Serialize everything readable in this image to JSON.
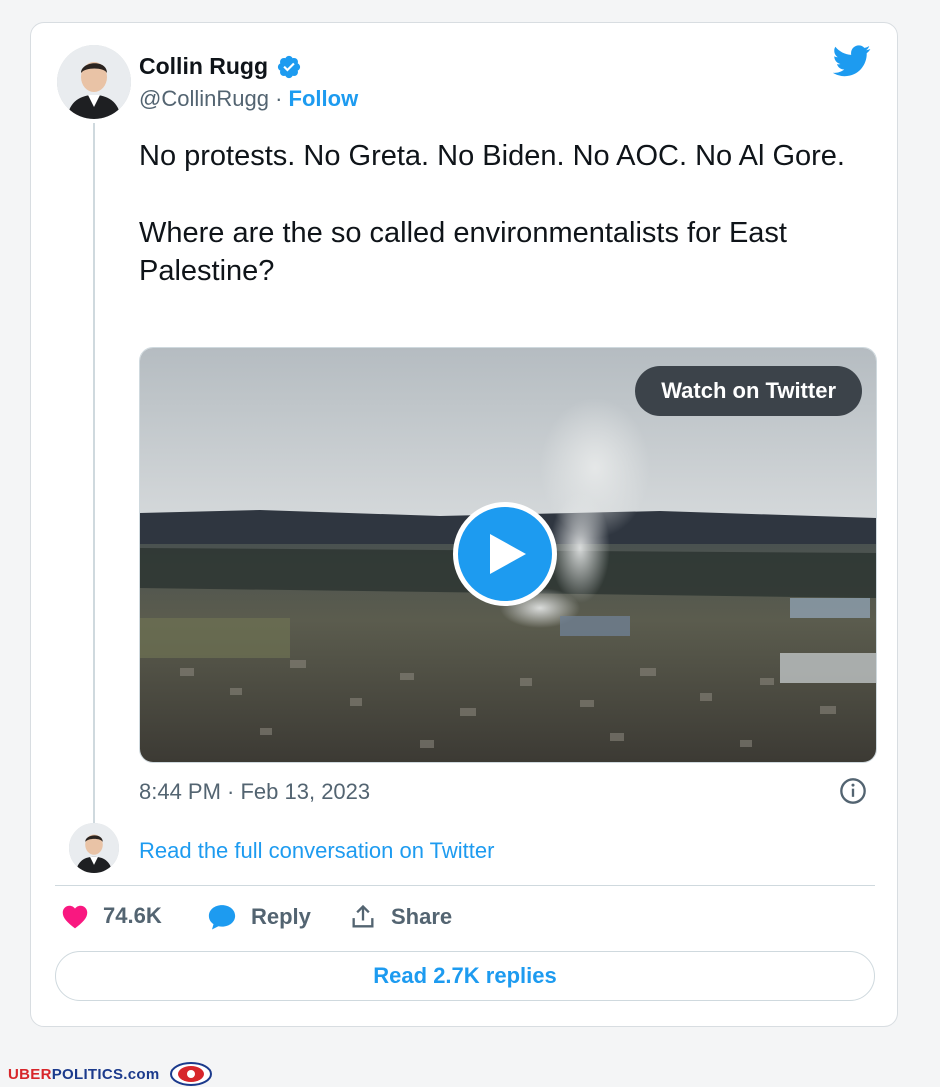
{
  "tweet": {
    "author_name": "Collin Rugg",
    "author_handle": "@CollinRugg",
    "separator": "·",
    "follow_label": "Follow",
    "text_paragraphs": [
      "No protests. No Greta. No Biden. No AOC. No Al Gore.",
      "Where are the so called environmentalists for East Palestine?"
    ],
    "media": {
      "watch_label": "Watch on Twitter"
    },
    "timestamp": "8:44 PM · Feb 13, 2023",
    "read_conversation_label": "Read the full conversation on Twitter",
    "actions": {
      "likes": "74.6K",
      "reply_label": "Reply",
      "share_label": "Share"
    },
    "read_replies_label": "Read 2.7K replies"
  },
  "colors": {
    "accent": "#1d9bf0",
    "like": "#f91880",
    "text": "#0f1419",
    "muted": "#536471"
  },
  "icons": [
    "verified-badge-icon",
    "twitter-bird-icon",
    "play-icon",
    "info-icon",
    "heart-icon",
    "reply-bubble-icon",
    "share-icon"
  ],
  "footer": {
    "brand_uber": "UBER",
    "brand_politics": "POLITICS",
    "brand_dotcom": ".com"
  }
}
